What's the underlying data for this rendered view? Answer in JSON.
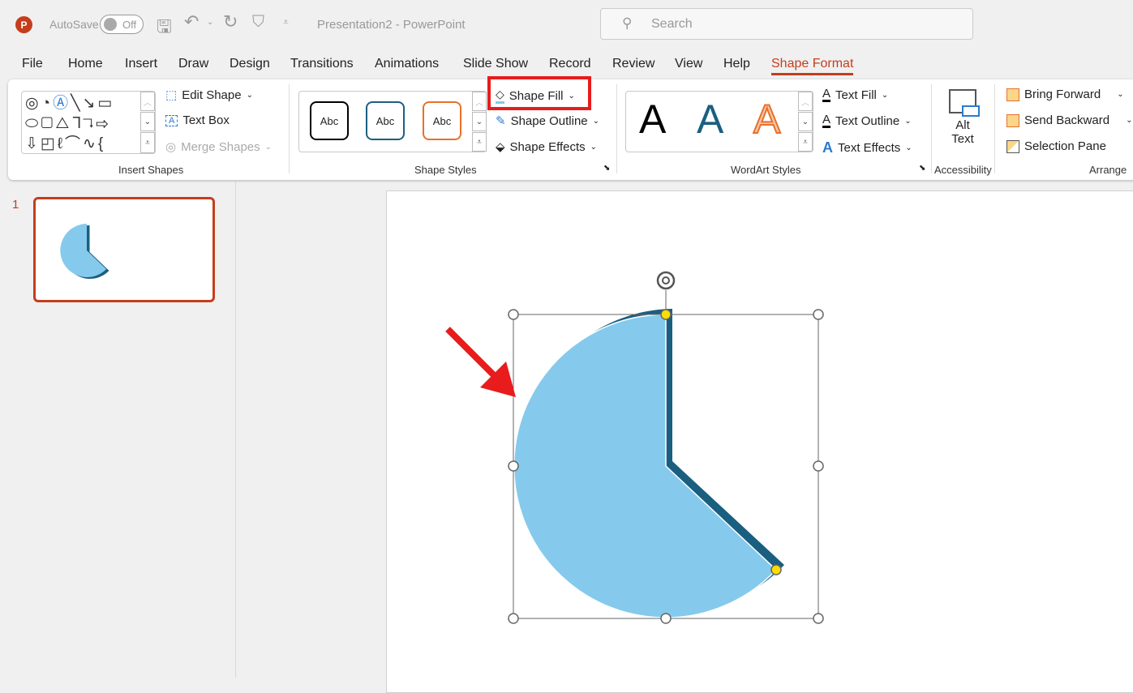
{
  "titlebar": {
    "autosave": "AutoSave",
    "toggle": "Off",
    "title": "Presentation2  -  PowerPoint",
    "search_placeholder": "Search"
  },
  "tabs": [
    "File",
    "Home",
    "Insert",
    "Draw",
    "Design",
    "Transitions",
    "Animations",
    "Slide Show",
    "Record",
    "Review",
    "View",
    "Help",
    "Shape Format"
  ],
  "active_tab": "Shape Format",
  "ribbon": {
    "insert_shapes": {
      "label": "Insert Shapes",
      "edit_shape": "Edit Shape",
      "text_box": "Text Box",
      "merge_shapes": "Merge Shapes"
    },
    "shape_styles": {
      "label": "Shape Styles",
      "presets": [
        "Abc",
        "Abc",
        "Abc"
      ],
      "preset_colors": [
        "#000000",
        "#1a5f80",
        "#e8702a"
      ],
      "shape_fill": "Shape Fill",
      "shape_outline": "Shape Outline",
      "shape_effects": "Shape Effects"
    },
    "wordart": {
      "label": "WordArt Styles",
      "presets": [
        "A",
        "A",
        "A"
      ],
      "text_fill": "Text Fill",
      "text_outline": "Text Outline",
      "text_effects": "Text Effects"
    },
    "accessibility": {
      "label": "Accessibility",
      "alt_text_1": "Alt",
      "alt_text_2": "Text"
    },
    "arrange": {
      "label": "Arrange",
      "bring_forward": "Bring Forward",
      "send_backward": "Send Backward",
      "selection_pane": "Selection Pane"
    }
  },
  "slides": {
    "number": "1"
  },
  "colors": {
    "accent": "#c43e1c",
    "pie_fill": "#85caec",
    "pie_outline": "#1a5f80",
    "highlight": "#e81c1c"
  }
}
